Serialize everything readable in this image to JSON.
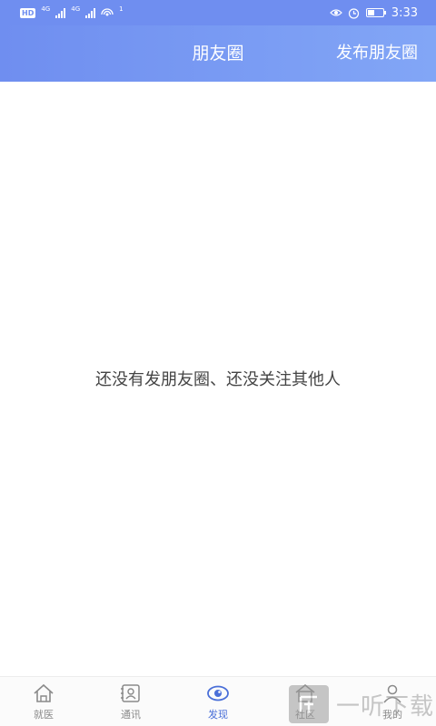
{
  "status_bar": {
    "hd": "HD",
    "net1": "4G",
    "net2": "4G",
    "wifi_badge": "1",
    "time": "3:33",
    "battery_level": 0.45,
    "icons": [
      "eye-icon",
      "alarm-icon",
      "battery-icon"
    ]
  },
  "header": {
    "title": "朋友圈",
    "action": "发布朋友圈"
  },
  "content": {
    "empty_message": "还没有发朋友圈、还没关注其他人"
  },
  "tabs": [
    {
      "label": "就医",
      "icon": "home-icon",
      "active": false
    },
    {
      "label": "通讯",
      "icon": "contacts-icon",
      "active": false
    },
    {
      "label": "发现",
      "icon": "discover-eye-icon",
      "active": true
    },
    {
      "label": "社区",
      "icon": "community-icon",
      "active": false
    },
    {
      "label": "我的",
      "icon": "person-icon",
      "active": false
    }
  ],
  "watermark": {
    "text": "一听下载"
  },
  "colors": {
    "header": "#6f8ef0",
    "active_tab": "#4a6fd8",
    "inactive_tab": "#8a8a8a"
  }
}
